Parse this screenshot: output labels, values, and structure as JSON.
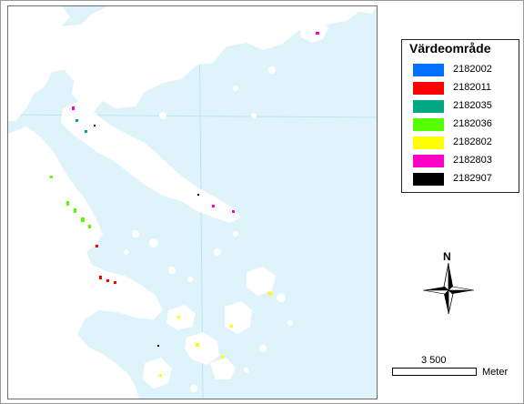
{
  "legend": {
    "title": "Värdeområde",
    "items": [
      {
        "label": "2182002",
        "color": "#0070ff"
      },
      {
        "label": "2182011",
        "color": "#ff0000"
      },
      {
        "label": "2182035",
        "color": "#00a884"
      },
      {
        "label": "2182036",
        "color": "#55ff00"
      },
      {
        "label": "2182802",
        "color": "#ffff00"
      },
      {
        "label": "2182803",
        "color": "#ff00c5"
      },
      {
        "label": "2182907",
        "color": "#000000"
      }
    ]
  },
  "north_arrow": {
    "label": "N",
    "icon": "north-arrow-icon"
  },
  "scale_bar": {
    "value": "3 500",
    "unit": "Meter"
  },
  "colors": {
    "water": "#dff3fa",
    "land": "#ffffff",
    "grid": "#bfe3ee"
  }
}
